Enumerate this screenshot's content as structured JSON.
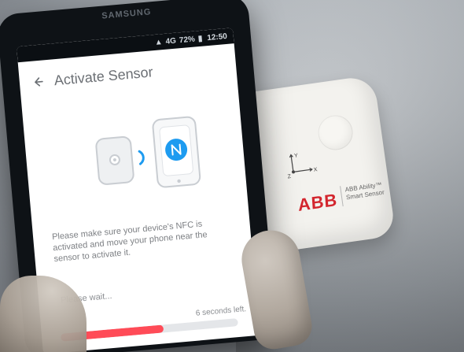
{
  "phone": {
    "brand": "SAMSUNG",
    "status_time": "12:50",
    "battery": "72%",
    "signal": "4G"
  },
  "app": {
    "title": "Activate Sensor",
    "instructions": "Please make sure your device's NFC is activated and move your phone near the sensor to activate it.",
    "status": "Please wait...",
    "countdown": "6 seconds left.",
    "progress_percent": 58
  },
  "sensor": {
    "brand": "ABB",
    "product_line1": "ABB Ability™",
    "product_line2": "Smart Sensor",
    "axis_labels": [
      "Y",
      "X",
      "Z"
    ]
  },
  "colors": {
    "abb_red": "#d3262e",
    "progress_red": "#ff4b57",
    "nfc_blue": "#1d9bf0"
  },
  "icons": {
    "back": "arrow-left-icon",
    "nfc": "nfc-icon",
    "sensor": "sensor-icon"
  }
}
